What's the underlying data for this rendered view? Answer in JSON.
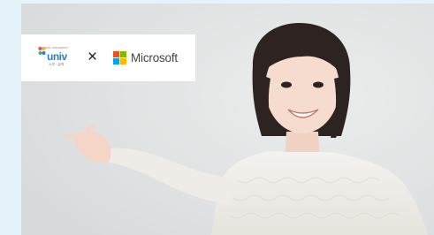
{
  "partner_logo": {
    "small_text": "ORIGINAL UNIVERSITY",
    "name": "univ",
    "subtitle": "大学・高専"
  },
  "separator": "×",
  "microsoft_logo": {
    "name": "Microsoft",
    "colors": {
      "red": "#f25022",
      "green": "#7fba00",
      "blue": "#00a4ef",
      "yellow": "#ffb900"
    }
  }
}
